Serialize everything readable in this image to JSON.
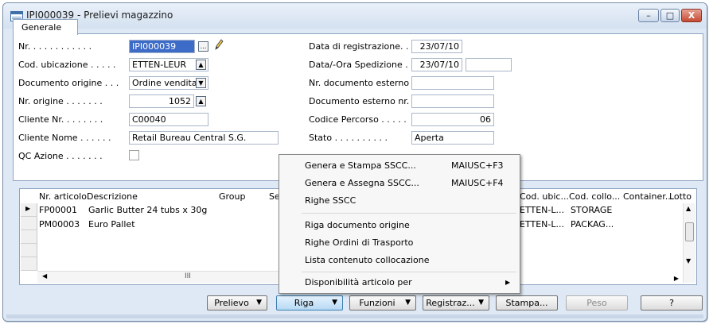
{
  "window": {
    "title": "IPI000039 - Prelievi magazzino",
    "controls": [
      "–",
      "□",
      "X"
    ]
  },
  "tab": {
    "label": "Generale"
  },
  "left_fields": [
    {
      "label": "Nr. . . . . . . . . . . .",
      "value": "IPI000039"
    },
    {
      "label": "Cod. ubicazione . . . . .",
      "value": "ETTEN-LEUR"
    },
    {
      "label": "Documento origine . . .",
      "value": "Ordine vendita"
    },
    {
      "label": "Nr. origine . . . . . . .",
      "value": "1052"
    },
    {
      "label": "Cliente Nr. . . . . . . .",
      "value": "C00040"
    },
    {
      "label": "Cliente Nome . . . . . .",
      "value": "Retail Bureau Central S.G."
    },
    {
      "label": "QC Azione . . . . . . .",
      "value": ""
    }
  ],
  "right_fields": [
    {
      "label": "Data di registrazione. . .",
      "value": "23/07/10"
    },
    {
      "label": "Data/-Ora Spedizione . .",
      "value": "23/07/10"
    },
    {
      "label": "Nr. documento esterno .",
      "value": ""
    },
    {
      "label": "Documento esterno nr. 2",
      "value": ""
    },
    {
      "label": "Codice Percorso . . . . .",
      "value": "06"
    },
    {
      "label": "Stato . . . . . . . . . .",
      "value": "Aperta"
    }
  ],
  "grid": {
    "headers": [
      "Nr. articolo",
      "Descrizione",
      "Group",
      "Se",
      "Cod. ubic...",
      "Cod. collo...",
      "Container...",
      "Lotto"
    ],
    "rows": [
      {
        "nr": "FP00001",
        "desc": "Garlic Butter 24 tubs x 30g",
        "ubic": "ETTEN-L...",
        "collo": "STORAGE"
      },
      {
        "nr": "PM00003",
        "desc": "Euro Pallet",
        "ubic": "ETTEN-L...",
        "collo": "PACKAG..."
      }
    ],
    "hscroll_thumb": "III"
  },
  "menu": {
    "items": [
      {
        "label": "Genera e Stampa SSCC...",
        "shortcut": "MAIUSC+F3"
      },
      {
        "label": "Genera e Assegna SSCC...",
        "shortcut": "MAIUSC+F4"
      },
      {
        "label": "Righe SSCC",
        "shortcut": ""
      },
      {
        "label": "Riga documento origine",
        "shortcut": ""
      },
      {
        "label": "Righe Ordini di Trasporto",
        "shortcut": ""
      },
      {
        "label": "Lista contenuto collocazione",
        "shortcut": ""
      },
      {
        "label": "Disponibilità articolo per",
        "shortcut": ""
      }
    ]
  },
  "buttons": {
    "prelievo": "Prelievo",
    "riga": "Riga",
    "funzioni": "Funzioni",
    "registraz": "Registraz...",
    "stampa": "Stampa...",
    "peso": "Peso",
    "help": "?"
  },
  "colors": {
    "selection": "#3d6cc8",
    "titlebar": "#d4e1f0",
    "close": "#c44a33"
  }
}
